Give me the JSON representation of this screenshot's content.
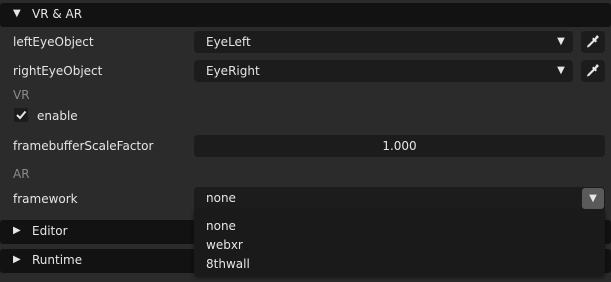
{
  "vr_ar_panel": {
    "title": "VR & AR",
    "toggle_icon": "triangle-down-icon"
  },
  "fields": {
    "left_eye": {
      "label": "leftEyeObject",
      "value": "EyeLeft"
    },
    "right_eye": {
      "label": "rightEyeObject",
      "value": "EyeRight"
    },
    "vr_section": "VR",
    "enable": {
      "label": "enable",
      "checked": true
    },
    "framebuffer": {
      "label": "framebufferScaleFactor",
      "value": "1.000"
    },
    "ar_section": "AR",
    "framework": {
      "label": "framework",
      "value": "none",
      "options": [
        "none",
        "webxr",
        "8thwall"
      ]
    }
  },
  "collapsed_panels": {
    "editor": "Editor",
    "runtime": "Runtime"
  },
  "icons": {
    "dropdown": "chevron-down-icon",
    "picker": "eyedropper-icon",
    "collapsed": "triangle-right-icon"
  },
  "colors": {
    "background": "#2b2b2b",
    "panel_header": "#121212",
    "field": "#1c1c1c",
    "text": "#e6e6e6",
    "muted": "#8a8a8a"
  }
}
